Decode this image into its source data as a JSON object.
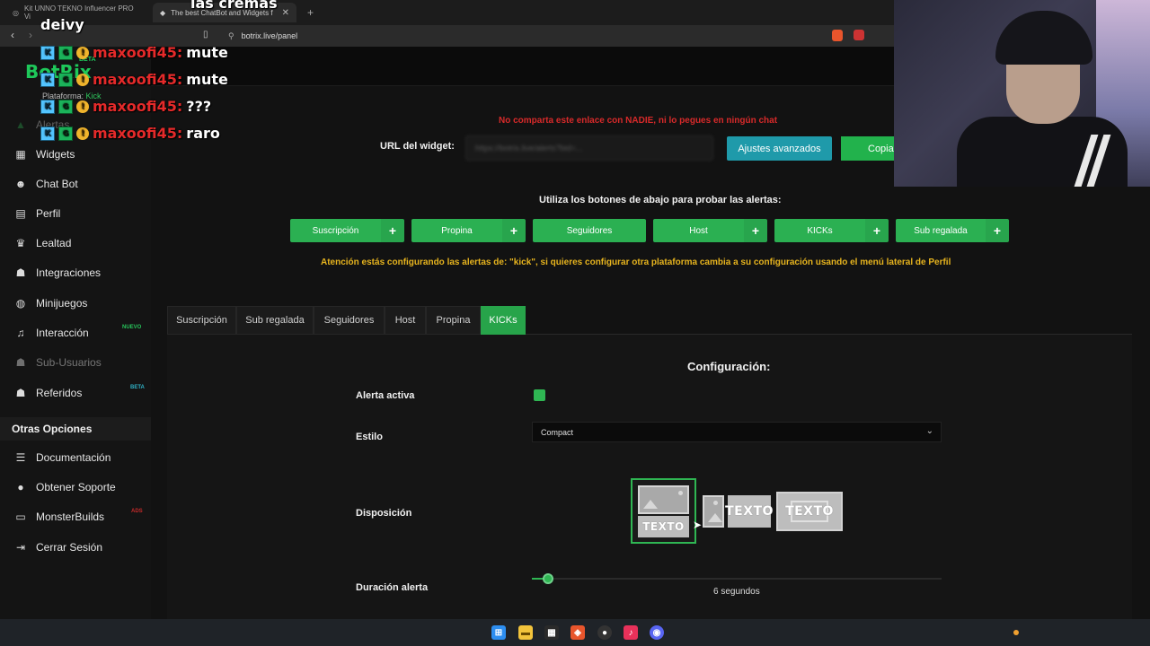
{
  "browser": {
    "tabs": [
      {
        "title": "Kit UNNO TEKNO Influencer PRO Vi",
        "active": false
      },
      {
        "title": "The best ChatBot and Widgets f",
        "active": true
      }
    ],
    "new_tab_symbol": "+",
    "url": "botrix.live/panel"
  },
  "brand": {
    "logo": "BotRix",
    "beta": "BETA",
    "platform_label": "Plataforma:",
    "platform_value": "Kick"
  },
  "sidebar": {
    "items": [
      {
        "label": "Alertas",
        "icon": "warning-icon"
      },
      {
        "label": "Widgets",
        "icon": "grid-icon"
      },
      {
        "label": "Chat Bot",
        "icon": "robot-icon"
      },
      {
        "label": "Perfil",
        "icon": "id-card-icon"
      },
      {
        "label": "Lealtad",
        "icon": "trophy-icon"
      },
      {
        "label": "Integraciones",
        "icon": "users-icon"
      },
      {
        "label": "Minijuegos",
        "icon": "gamepad-icon"
      },
      {
        "label": "Interacción",
        "icon": "music-icon",
        "badge": "NUEVO"
      },
      {
        "label": "Sub-Usuarios",
        "icon": "users-icon"
      },
      {
        "label": "Referidos",
        "icon": "users-icon",
        "badge": "BETA"
      }
    ],
    "section_title": "Otras Opciones",
    "other_items": [
      {
        "label": "Documentación",
        "icon": "list-icon"
      },
      {
        "label": "Obtener Soporte",
        "icon": "support-icon"
      },
      {
        "label": "MonsterBuilds",
        "icon": "laptop-icon",
        "badge": "ADS"
      },
      {
        "label": "Cerrar Sesión",
        "icon": "logout-icon"
      }
    ]
  },
  "widget": {
    "warning": "No comparta este enlace con NADIE, ni lo pegues en ningún chat",
    "url_label": "URL del widget:",
    "url_value": "https://botrix.live/alerts?bid=...",
    "advanced_button": "Ajustes avanzados",
    "copy_button": "Copia"
  },
  "test": {
    "instruction": "Utiliza los botones de abajo para probar las alertas:",
    "buttons": [
      {
        "label": "Suscripción",
        "plus": true
      },
      {
        "label": "Propina",
        "plus": true
      },
      {
        "label": "Seguidores",
        "plus": false
      },
      {
        "label": "Host",
        "plus": true
      },
      {
        "label": "KICKs",
        "plus": true
      },
      {
        "label": "Sub regalada",
        "plus": true
      }
    ],
    "plus_symbol": "+"
  },
  "attention": "Atención estás configurando las alertas de: \"kick\", si quieres configurar otra plataforma cambia a su configuración usando el menú lateral de Perfil",
  "config_tabs": [
    {
      "label": "Suscripción",
      "active": false
    },
    {
      "label": "Sub regalada",
      "active": false
    },
    {
      "label": "Seguidores",
      "active": false
    },
    {
      "label": "Host",
      "active": false
    },
    {
      "label": "Propina",
      "active": false
    },
    {
      "label": "KICKs",
      "active": true
    }
  ],
  "config": {
    "title": "Configuración:",
    "alert_active_label": "Alerta activa",
    "alert_active": true,
    "style_label": "Estilo",
    "style_value": "Compact",
    "layout_label": "Disposición",
    "layout_options": [
      {
        "text": "TEXTO",
        "selected": true
      },
      {
        "text": "TEXTO",
        "selected": false
      },
      {
        "text": "TEXTO",
        "selected": false
      }
    ],
    "duration_label": "Duración alerta",
    "duration_value": "6 segundos",
    "duration_fraction": 0.04
  },
  "chat_overlay": [
    {
      "user": "",
      "message": "las cremas"
    },
    {
      "user": "",
      "message": "deivy"
    },
    {
      "user": "maxoofi45:",
      "message": "mute"
    },
    {
      "user": "maxoofi45:",
      "message": "mute"
    },
    {
      "user": "maxoofi45:",
      "message": "???"
    },
    {
      "user": "maxoofi45:",
      "message": "raro"
    }
  ],
  "colors": {
    "green": "#2bb052",
    "blue": "#1f9aaa",
    "warning_red": "#d82a2a",
    "attention_yellow": "#e7b41e"
  }
}
